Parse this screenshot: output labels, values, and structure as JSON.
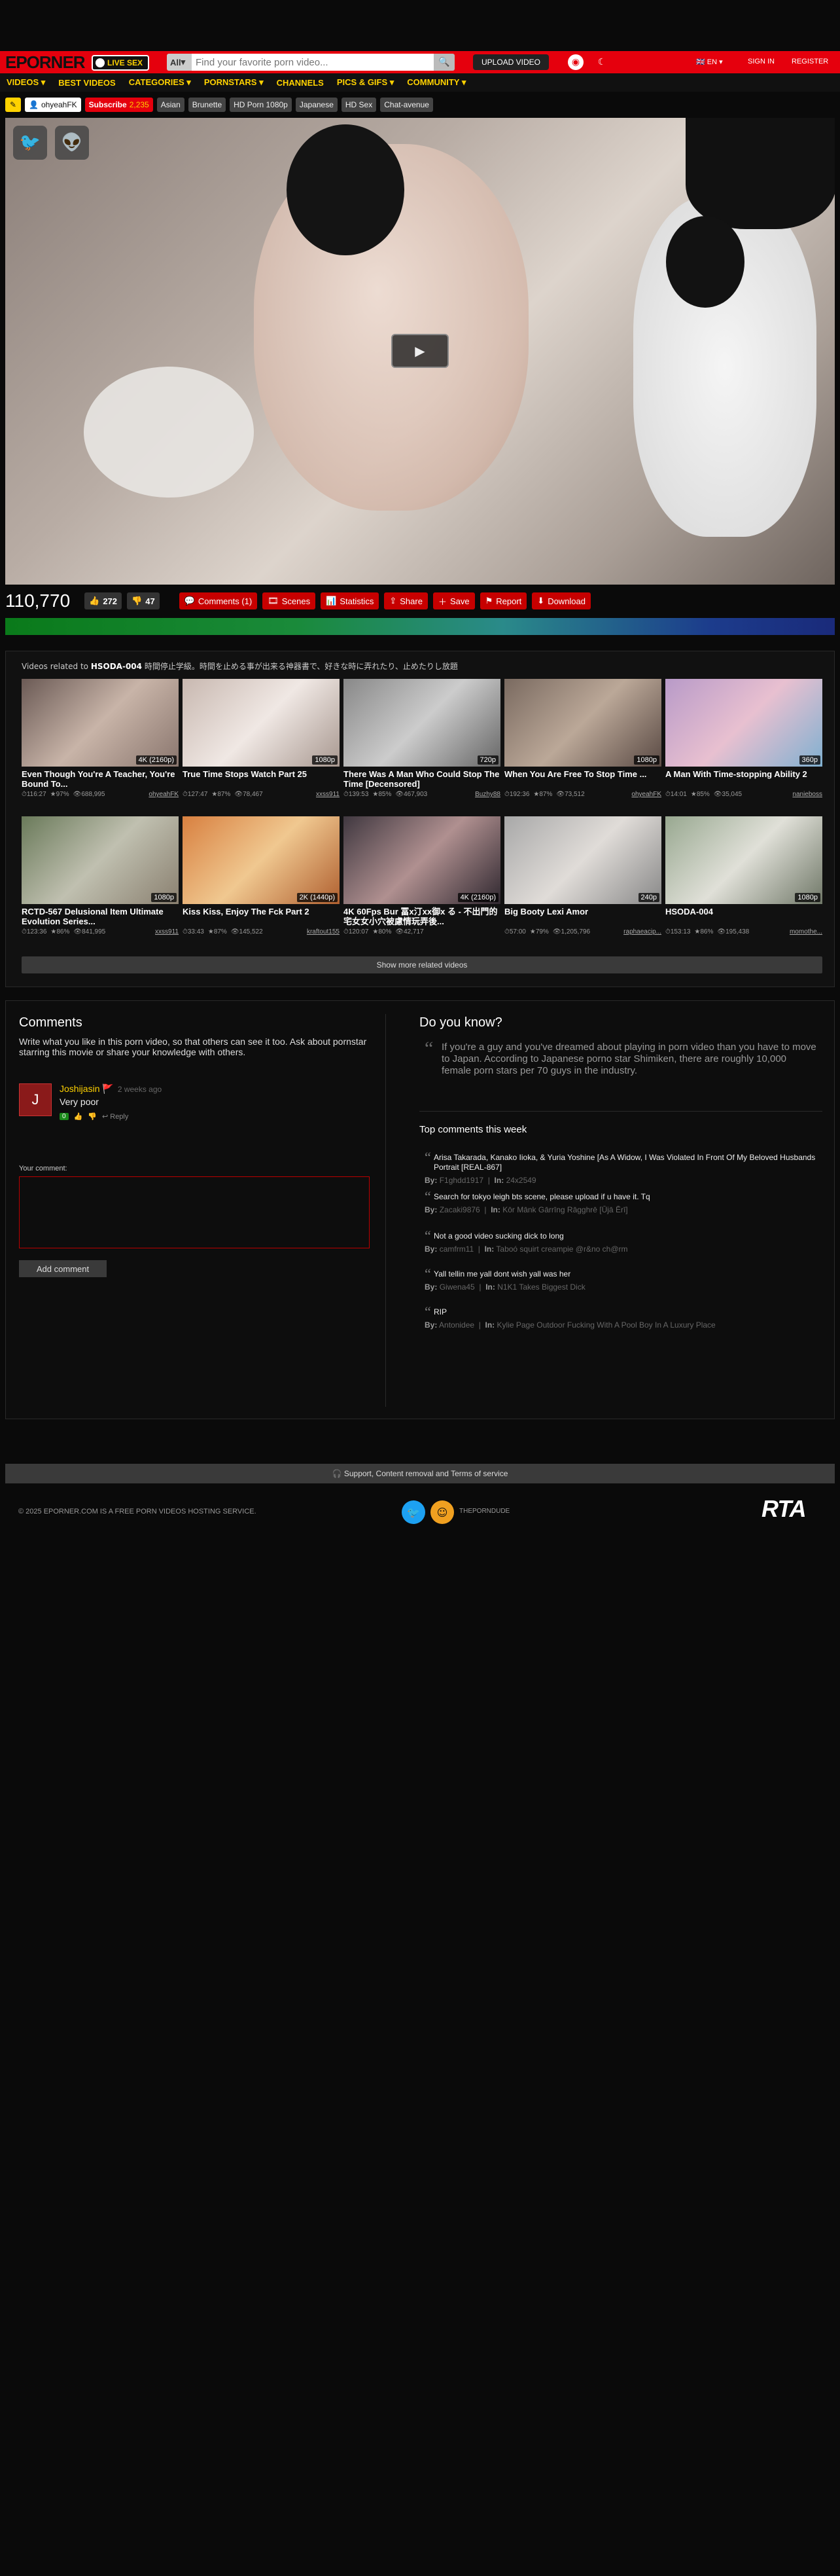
{
  "header": {
    "logo": "EPORNER",
    "livesex": "LIVE SEX",
    "search_scope": "All",
    "search_placeholder": "Find your favorite porn video...",
    "upload": "UPLOAD VIDEO",
    "lang": "EN",
    "signin": "SIGN IN",
    "register": "REGISTER"
  },
  "nav": [
    "VIDEOS ▾",
    "BEST VIDEOS",
    "CATEGORIES ▾",
    "PORNSTARS ▾",
    "CHANNELS",
    "PICS & GIFS ▾",
    "COMMUNITY ▾"
  ],
  "tags": {
    "channel": "ohyeahFK",
    "subscribe": "Subscribe",
    "subscribers": "2,235",
    "items": [
      "Asian",
      "Brunette",
      "HD Porn 1080p",
      "Japanese",
      "HD Sex",
      "Chat-avenue"
    ]
  },
  "stats": {
    "views": "110,770",
    "likes": "272",
    "dislikes": "47",
    "buttons": [
      "Comments (1)",
      "Scenes",
      "Statistics",
      "Share",
      "Save",
      "Report",
      "Download"
    ]
  },
  "related": {
    "prefix": "Videos related to",
    "code": "HSODA-004",
    "title": "時間停止学級。時間を止める事が出来る神器書で、好きな時に弄れたり、止めたりし放題",
    "videos": [
      {
        "quality": "4K (2160p)",
        "title": "Even Though You're A Teacher, You're Bound To...",
        "duration": "116:27",
        "rating": "97%",
        "views": "688,995",
        "user": "ohyeahFK"
      },
      {
        "quality": "1080p",
        "title": "True Time Stops Watch Part 25",
        "duration": "127:47",
        "rating": "87%",
        "views": "78,467",
        "user": "xxss911"
      },
      {
        "quality": "720p",
        "title": "There Was A Man Who Could Stop The Time [Decensored]",
        "duration": "139:53",
        "rating": "85%",
        "views": "467,903",
        "user": "Buzhy88"
      },
      {
        "quality": "1080p",
        "title": "When You Are Free To Stop Time ...",
        "duration": "192:36",
        "rating": "87%",
        "views": "73,512",
        "user": "ohyeahFK"
      },
      {
        "quality": "360p",
        "title": "A Man With Time-stopping Ability 2",
        "duration": "14:01",
        "rating": "85%",
        "views": "35,045",
        "user": "nanieboss"
      },
      {
        "quality": "1080p",
        "title": "RCTD-567 Delusional Item Ultimate Evolution Series...",
        "duration": "123:36",
        "rating": "86%",
        "views": "841,995",
        "user": "xxss911"
      },
      {
        "quality": "2K (1440p)",
        "title": "Kiss Kiss, Enjoy The Fck Part 2",
        "duration": "33:43",
        "rating": "87%",
        "views": "145,522",
        "user": "kraftout155"
      },
      {
        "quality": "4K (2160p)",
        "title": "4K 60Fps Bur 冨x汀xx御x る - 不出門的宅女女小穴被慮情玩弄後...",
        "duration": "120:07",
        "rating": "80%",
        "views": "42,717",
        "user": ""
      },
      {
        "quality": "240p",
        "title": "Big Booty Lexi Amor",
        "duration": "57:00",
        "rating": "79%",
        "views": "1,205,796",
        "user": "raphaeacip..."
      },
      {
        "quality": "1080p",
        "title": "HSODA-004",
        "duration": "153:13",
        "rating": "86%",
        "views": "195,438",
        "user": "momothe..."
      }
    ],
    "more": "Show more related videos"
  },
  "comments": {
    "heading": "Comments",
    "desc": "Write what you like in this porn video, so that others can see it too. Ask about pornstar starring this movie or share your knowledge with others.",
    "avatar": "J",
    "user": "Joshijasin",
    "time": "2 weeks ago",
    "text": "Very poor",
    "score": "0",
    "reply": "Reply",
    "label": "Your comment:",
    "add": "Add comment"
  },
  "didyouknow": {
    "heading": "Do you know?",
    "text": "If you're a guy and you've dreamed about playing in porn video than you have to move to Japan. According to Japanese porno star Shimiken, there are roughly 10,000 female porn stars per 70 guys in the industry."
  },
  "topcomments": {
    "heading": "Top comments this week",
    "items": [
      {
        "text": "Arisa Takarada, Kanako Iioka, & Yuria Yoshine [As A Widow, I Was Violated In Front Of My Beloved Husbands Portrait [REAL-867]",
        "by": "F1ghdd1917",
        "in": "24x2549"
      },
      {
        "text": "Search for tokyo leigh bts scene, please upload if u have it. Tq",
        "by": "Zacaki9876",
        "in": "Kōr Mānk Gārrīng Rāgghrē [Ūjā Ērī]"
      },
      {
        "text": "Not a good video sucking dick to long",
        "by": "camfrm11",
        "in": "Taboó squirt creampie @r&no ch@rm"
      },
      {
        "text": "Yall tellin me yall dont wish yall was her",
        "by": "Giwena45",
        "in": "N1K1 Takes Biggest Dick"
      },
      {
        "text": "RIP",
        "by": "Antonidee",
        "in": "Kylie Page Outdoor Fucking With A Pool Boy In A Luxury Place"
      }
    ],
    "by_label": "By:",
    "in_label": "In:"
  },
  "footer": {
    "support": "Support, Content removal and Terms of service",
    "copyright": "© 2025 EPORNER.COM IS A FREE PORN VIDEOS HOSTING SERVICE.",
    "porndude": "THEPORNDUDE",
    "rta": "RTA"
  }
}
